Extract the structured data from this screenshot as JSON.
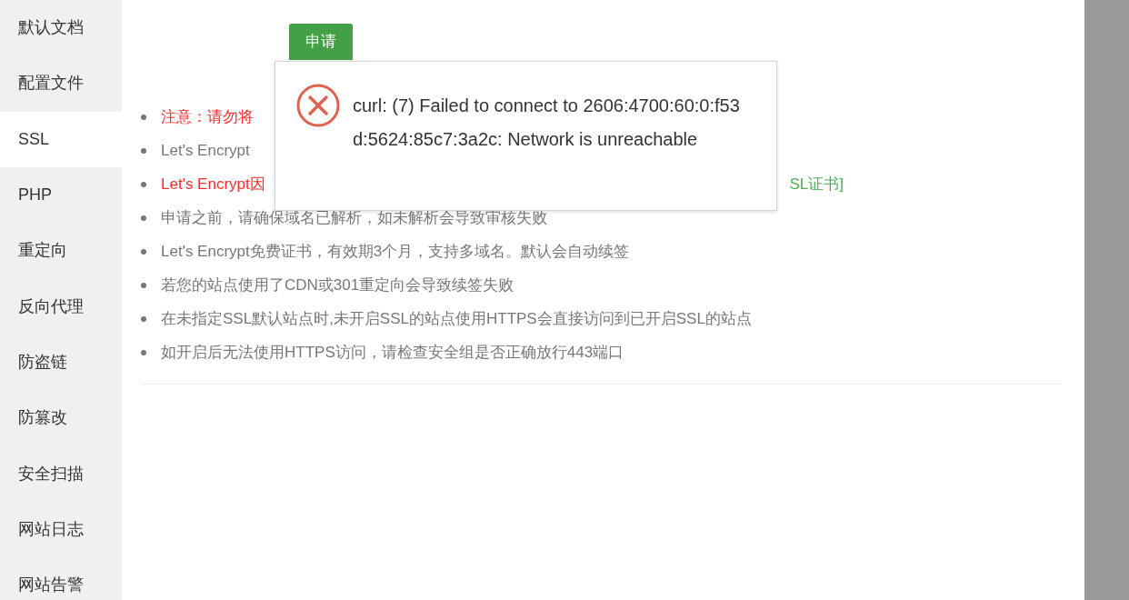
{
  "sidebar": {
    "items": [
      {
        "label": "默认文档",
        "selected": false
      },
      {
        "label": "配置文件",
        "selected": false
      },
      {
        "label": "SSL",
        "selected": true
      },
      {
        "label": "PHP",
        "selected": false
      },
      {
        "label": "重定向",
        "selected": false
      },
      {
        "label": "反向代理",
        "selected": false
      },
      {
        "label": "防盗链",
        "selected": false
      },
      {
        "label": "防篡改",
        "selected": false
      },
      {
        "label": "安全扫描",
        "selected": false
      },
      {
        "label": "网站日志",
        "selected": false
      },
      {
        "label": "网站告警",
        "selected": false
      }
    ]
  },
  "apply_button": "申请",
  "notes": [
    {
      "kind": "warning",
      "text": "注意：请勿将"
    },
    {
      "kind": "normal",
      "text": "Let's Encrypt"
    },
    {
      "kind": "warning",
      "text": "Let's Encrypt因",
      "tail": "SL证书]"
    },
    {
      "kind": "normal",
      "text": "申请之前，请确保域名已解析，如未解析会导致审核失败"
    },
    {
      "kind": "normal",
      "text": "Let's Encrypt免费证书，有效期3个月，支持多域名。默认会自动续签"
    },
    {
      "kind": "normal",
      "text": "若您的站点使用了CDN或301重定向会导致续签失败"
    },
    {
      "kind": "normal",
      "text": "在未指定SSL默认站点时,未开启SSL的站点使用HTTPS会直接访问到已开启SSL的站点"
    },
    {
      "kind": "normal",
      "text": "如开启后无法使用HTTPS访问，请检查安全组是否正确放行443端口"
    }
  ],
  "error_dialog": {
    "message": "curl: (7) Failed to connect to 2606:4700:60:0:f53d:5624:85c7:3a2c: Network is unreachable"
  }
}
